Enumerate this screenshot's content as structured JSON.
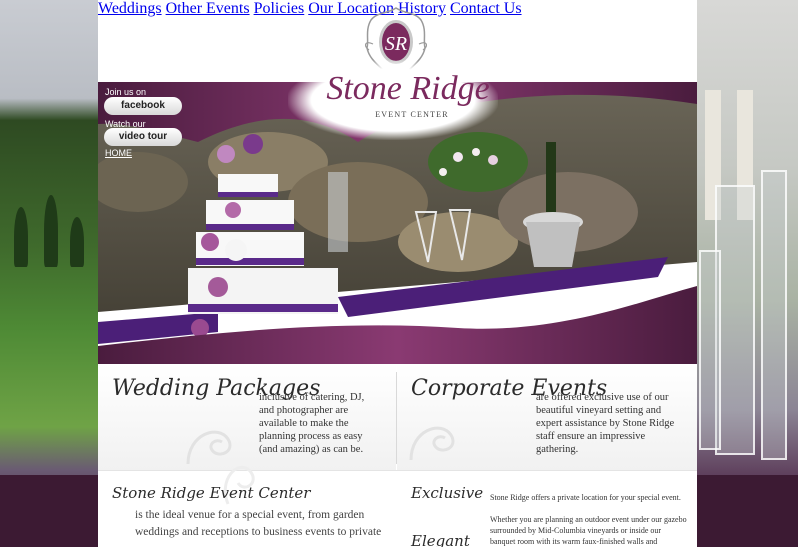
{
  "nav": {
    "left": [
      "Weddings",
      "Other Events",
      "Policies"
    ],
    "right": [
      "Our Location",
      "History",
      "Contact Us"
    ]
  },
  "logo": {
    "monogram": "SR",
    "name": "Stone Ridge",
    "subtitle": "EVENT CENTER"
  },
  "social": {
    "join_label": "Join us on",
    "facebook": "facebook",
    "watch_label": "Watch our",
    "video": "video tour",
    "home": "HOME"
  },
  "boxes": {
    "wedding": {
      "title": "Wedding Packages",
      "text": "inclusive of catering, DJ, and photographer are available to make the planning process as easy (and amazing) as can be."
    },
    "corporate": {
      "title": "Corporate Events",
      "text": "are offered exclusive use of our beautiful vineyard setting and expert assistance by Stone Ridge staff ensure an impressive gathering."
    }
  },
  "bottom": {
    "title": "Stone Ridge Event Center",
    "text": "is the ideal venue for a special event, from garden weddings and receptions to business events to private",
    "word1": "Exclusive",
    "word2": "Elegant",
    "p1": "Stone Ridge offers a private location for your special event.",
    "p2": "Whether you are planning an outdoor event under our gazebo surrounded by Mid-Columbia vineyards or inside our banquet room with its warm faux-finished walls and"
  },
  "colors": {
    "brand_purple": "#7b2a5e",
    "dark_plum": "#3c1a33"
  }
}
